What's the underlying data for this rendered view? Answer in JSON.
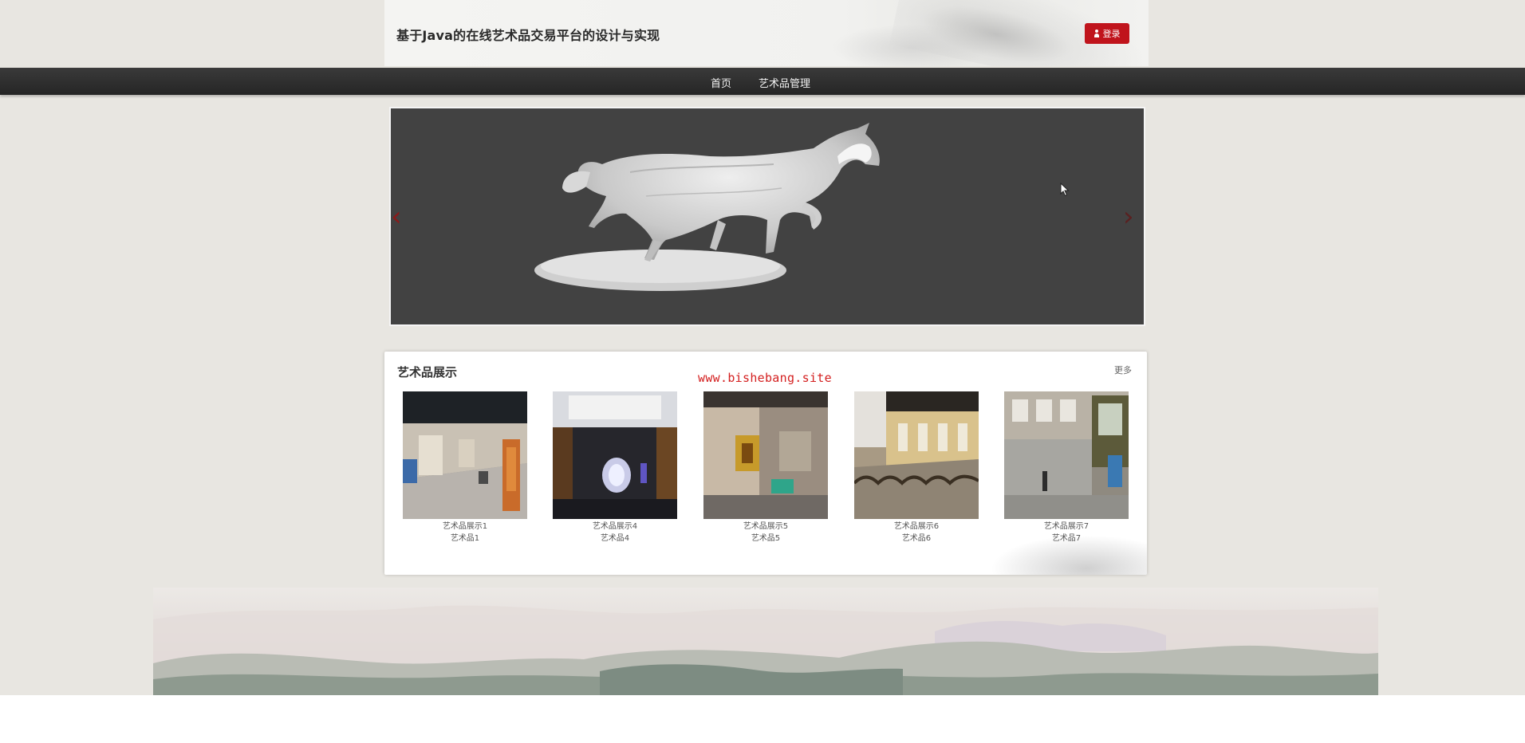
{
  "header": {
    "title": "基于Java的在线艺术品交易平台的设计与实现",
    "login_label": "登录"
  },
  "nav": {
    "items": [
      {
        "label": "首页"
      },
      {
        "label": "艺术品管理"
      }
    ]
  },
  "carousel": {
    "prev_icon": "chevron-left-icon",
    "next_icon": "chevron-right-icon",
    "prev_glyph": "‹",
    "next_glyph": "›"
  },
  "watermark": "www.bishebang.site",
  "showcase": {
    "title": "艺术品展示",
    "more_label": "更多",
    "items": [
      {
        "name": "艺术品展示1",
        "price": "艺术品1"
      },
      {
        "name": "艺术品展示4",
        "price": "艺术品4"
      },
      {
        "name": "艺术品展示5",
        "price": "艺术品5"
      },
      {
        "name": "艺术品展示6",
        "price": "艺术品6"
      },
      {
        "name": "艺术品展示7",
        "price": "艺术品7"
      }
    ]
  },
  "colors": {
    "accent": "#c0141c",
    "nav_bg": "#2b2b2b",
    "page_bg": "#e8e6e1"
  }
}
